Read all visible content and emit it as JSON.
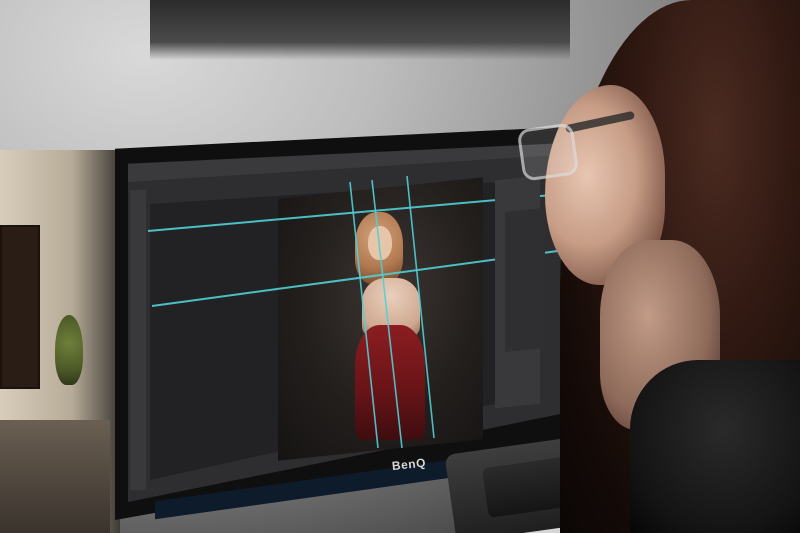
{
  "monitor": {
    "brand_label": "BenQ"
  },
  "colors": {
    "guide_lines": "#4fd0d6",
    "dress": "#7b171b",
    "monitor_bezel": "#0f0f10",
    "photoshop_ui": "#2e2e30"
  },
  "icons": {
    "photoshop_tools": "tools-panel-icon",
    "taskbar": "taskbar-icon"
  }
}
